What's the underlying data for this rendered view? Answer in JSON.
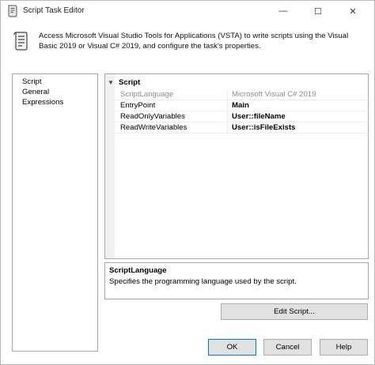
{
  "window": {
    "title": "Script Task Editor",
    "controls": {
      "minimize": "—",
      "maximize": "☐",
      "close": "✕"
    }
  },
  "description": "Access Microsoft Visual Studio Tools for Applications (VSTA) to write scripts using the Visual Basic 2019 or Visual C# 2019, and configure the task's properties.",
  "nav": {
    "items": [
      {
        "label": "Script",
        "selected": true
      },
      {
        "label": "General",
        "selected": false
      },
      {
        "label": "Expressions",
        "selected": false
      }
    ]
  },
  "properties": {
    "category": {
      "toggle": "▼",
      "label": "Script"
    },
    "rows": [
      {
        "name": "ScriptLanguage",
        "value": "Microsoft Visual C# 2019",
        "disabled": true
      },
      {
        "name": "EntryPoint",
        "value": "Main",
        "disabled": false
      },
      {
        "name": "ReadOnlyVariables",
        "value": "User::fileName",
        "disabled": false
      },
      {
        "name": "ReadWriteVariables",
        "value": "User::isFileExists",
        "disabled": false
      }
    ]
  },
  "help": {
    "title": "ScriptLanguage",
    "text": "Specifies the programming language used by the script."
  },
  "buttons": {
    "edit_script": "Edit Script...",
    "ok": "OK",
    "cancel": "Cancel",
    "help": "Help"
  }
}
